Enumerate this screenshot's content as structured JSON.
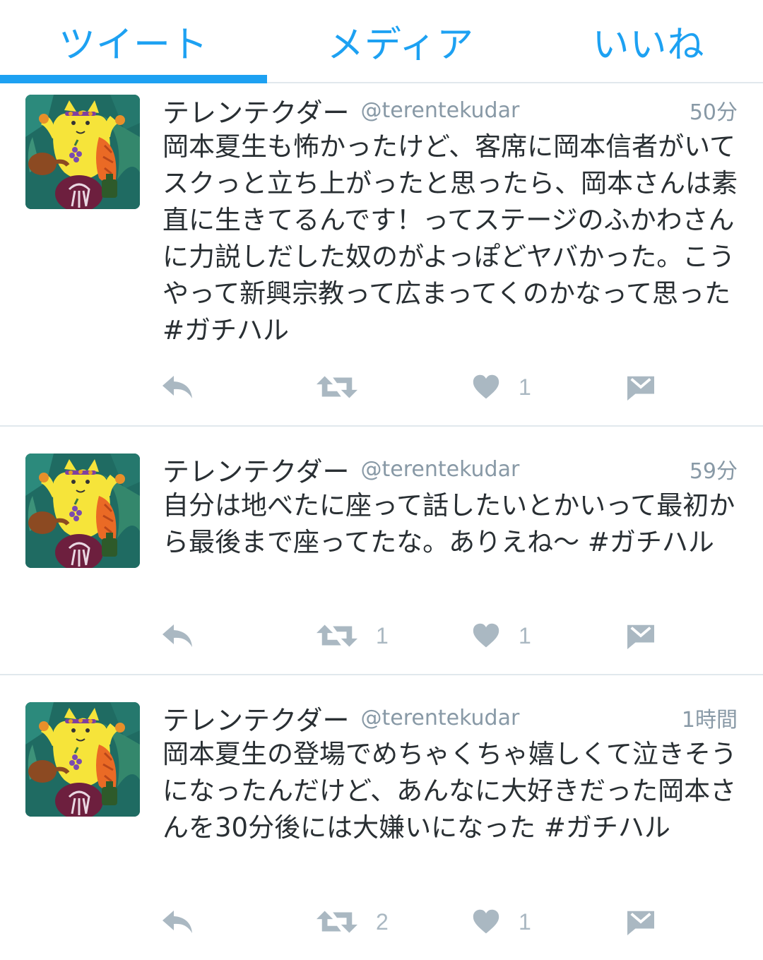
{
  "tabs": [
    {
      "label": "ツイート",
      "active": true
    },
    {
      "label": "メディア",
      "active": false
    },
    {
      "label": "いいね",
      "active": false
    }
  ],
  "colors": {
    "accent": "#1da1f2",
    "text": "#292f33",
    "muted": "#8899a6",
    "icon": "#aab8c2",
    "divider": "#e1e8ed"
  },
  "icons": {
    "reply": "reply-icon",
    "retweet": "retweet-icon",
    "like": "heart-icon",
    "dm": "direct-message-icon"
  },
  "tweets": [
    {
      "name": "テレンテクダー",
      "handle": "@terentekudar",
      "time": "50分",
      "text": "岡本夏生も怖かったけど、客席に岡本信者がいてスクっと立ち上がったと思ったら、岡本さんは素直に生きてるんです！ってステージのふかわさんに力説しだした奴のがよっぽどヤバかった。こうやって新興宗教って広まってくのかなって思った #ガチハル",
      "retweets": "",
      "likes": "1"
    },
    {
      "name": "テレンテクダー",
      "handle": "@terentekudar",
      "time": "59分",
      "text": "自分は地べたに座って話したいとかいって最初から最後まで座ってたな。ありえね〜 #ガチハル",
      "retweets": "1",
      "likes": "1"
    },
    {
      "name": "テレンテクダー",
      "handle": "@terentekudar",
      "time": "1時間",
      "text": "岡本夏生の登場でめちゃくちゃ嬉しくて泣きそうになったんだけど、あんなに大好きだった岡本さんを30分後には大嫌いになった #ガチハル",
      "retweets": "2",
      "likes": "1"
    }
  ]
}
